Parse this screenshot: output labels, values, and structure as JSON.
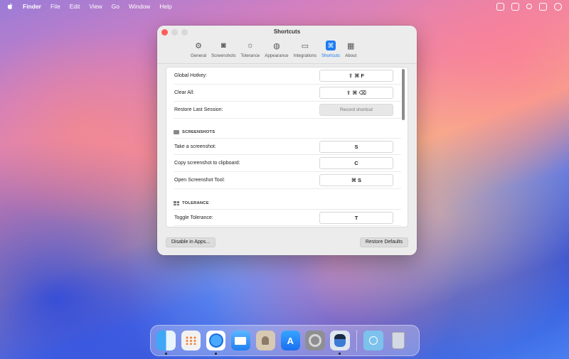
{
  "menubar": {
    "app_name": "Finder",
    "items": [
      "File",
      "Edit",
      "View",
      "Go",
      "Window",
      "Help"
    ]
  },
  "window": {
    "title": "Shortcuts",
    "tabs": [
      {
        "label": "General",
        "icon": "gear-icon"
      },
      {
        "label": "Screenshots",
        "icon": "camera-icon"
      },
      {
        "label": "Tolerance",
        "icon": "sun-icon"
      },
      {
        "label": "Appearance",
        "icon": "palette-icon"
      },
      {
        "label": "Integrations",
        "icon": "plug-icon"
      },
      {
        "label": "Shortcuts",
        "icon": "command-icon",
        "active": true
      },
      {
        "label": "About",
        "icon": "grid-icon"
      }
    ],
    "general_rows": [
      {
        "label": "Global Hotkey:",
        "shortcut": "⇧ ⌘ F"
      },
      {
        "label": "Clear All:",
        "shortcut": "⇧ ⌘ ⌫"
      },
      {
        "label": "Restore Last Session:",
        "shortcut": "Record shortcut"
      }
    ],
    "screenshots_section": {
      "title": "SCREENSHOTS",
      "rows": [
        {
          "label": "Take a screenshot:",
          "shortcut": "S"
        },
        {
          "label": "Copy screenshot to clipboard:",
          "shortcut": "C"
        },
        {
          "label": "Open Screenshot Tool:",
          "shortcut": "⌘ S"
        }
      ]
    },
    "tolerance_section": {
      "title": "TOLERANCE",
      "rows": [
        {
          "label": "Toggle Tolerance:",
          "shortcut": "T"
        }
      ]
    },
    "buttons": {
      "disable_in_apps": "Disable in Apps...",
      "restore_defaults": "Restore Defaults"
    },
    "accent_color": "#1d7bf2"
  },
  "dock": {
    "apps": [
      "Finder",
      "Launchpad",
      "Safari",
      "Mail",
      "Contacts",
      "App Store",
      "System Settings",
      "Shottr",
      "Downloads",
      "Trash"
    ]
  }
}
